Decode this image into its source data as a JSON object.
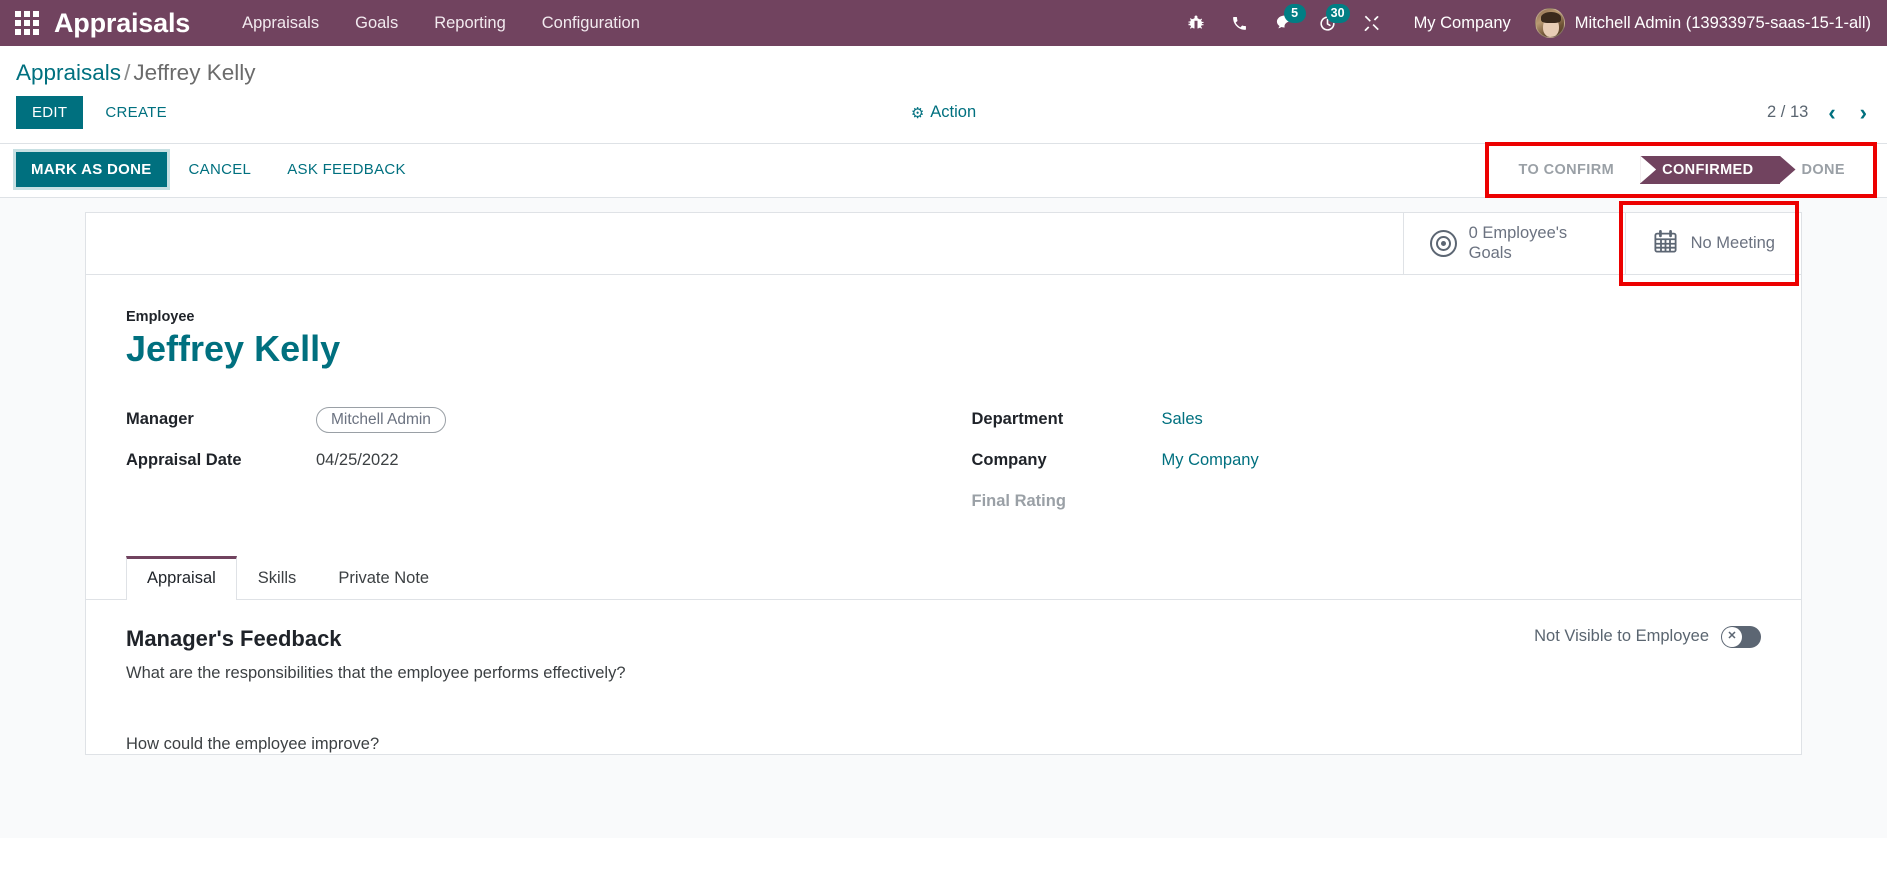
{
  "navbar": {
    "apps_icon": "apps-grid-icon",
    "brand": "Appraisals",
    "menu": [
      {
        "label": "Appraisals"
      },
      {
        "label": "Goals"
      },
      {
        "label": "Reporting"
      },
      {
        "label": "Configuration"
      }
    ],
    "sys_icons": [
      {
        "name": "bug-icon",
        "badge": null
      },
      {
        "name": "phone-icon",
        "badge": null
      },
      {
        "name": "messages-icon",
        "badge": "5"
      },
      {
        "name": "activity-clock-icon",
        "badge": "30"
      },
      {
        "name": "tools-icon",
        "badge": null
      }
    ],
    "company": "My Company",
    "user": "Mitchell Admin (13933975-saas-15-1-all)",
    "bg_color": "#71435F",
    "badge_color": "#017e84"
  },
  "control_panel": {
    "breadcrumb_root": "Appraisals",
    "breadcrumb_sep": "/",
    "breadcrumb_current": "Jeffrey Kelly",
    "edit_label": "EDIT",
    "create_label": "CREATE",
    "action_label": "Action",
    "action_icon": "gear-icon",
    "pager_text": "2 / 13",
    "pager_prev_icon": "chevron-left-icon",
    "pager_next_icon": "chevron-right-icon",
    "accent_color": "#00707f"
  },
  "statusbar": {
    "buttons": [
      {
        "label": "MARK AS DONE",
        "style": "primary"
      },
      {
        "label": "CANCEL",
        "style": "flat"
      },
      {
        "label": "ASK FEEDBACK",
        "style": "flat"
      }
    ],
    "stages": [
      {
        "label": "TO CONFIRM",
        "active": false
      },
      {
        "label": "CONFIRMED",
        "active": true
      },
      {
        "label": "DONE",
        "active": false
      }
    ],
    "highlight_color": "#ec0000"
  },
  "smart_buttons": [
    {
      "icon": "bullseye-icon",
      "label": "0 Employee's Goals",
      "highlighted": false
    },
    {
      "icon": "calendar-icon",
      "label": "No Meeting",
      "highlighted": true
    }
  ],
  "form": {
    "employee_label": "Employee",
    "employee_name": "Jeffrey Kelly",
    "left_fields": [
      {
        "label": "Manager",
        "value": "Mitchell Admin",
        "type": "tag"
      },
      {
        "label": "Appraisal Date",
        "value": "04/25/2022",
        "type": "text"
      }
    ],
    "right_fields": [
      {
        "label": "Department",
        "value": "Sales",
        "type": "link"
      },
      {
        "label": "Company",
        "value": "My Company",
        "type": "link"
      },
      {
        "label": "Final Rating",
        "value": "",
        "type": "empty"
      }
    ]
  },
  "notebook": {
    "tabs": [
      {
        "label": "Appraisal",
        "active": true
      },
      {
        "label": "Skills",
        "active": false
      },
      {
        "label": "Private Note",
        "active": false
      }
    ],
    "feedback_heading": "Manager's Feedback",
    "question_1": "What are the responsibilities that the employee performs effectively?",
    "question_2": "How could the employee improve?",
    "visibility_label": "Not Visible to Employee",
    "visibility_state": "off",
    "toggle_glyph": "✕"
  }
}
